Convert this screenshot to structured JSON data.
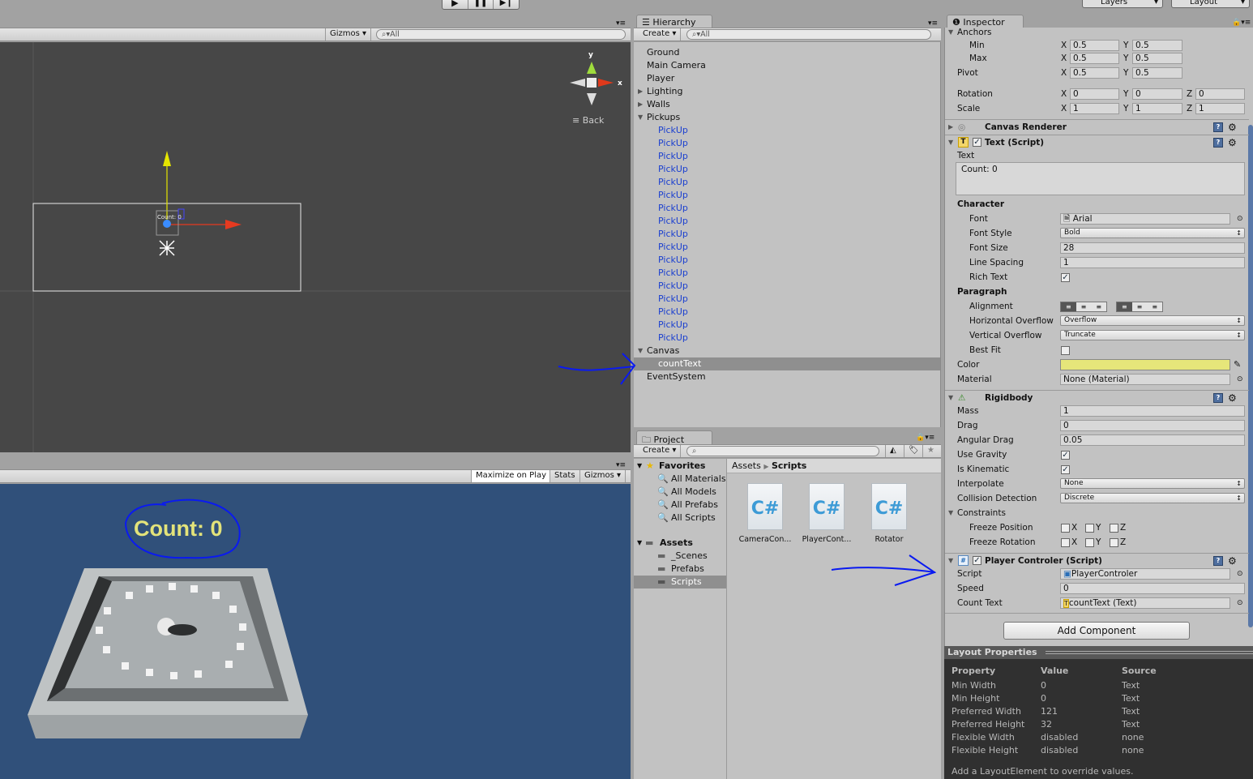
{
  "toolbar": {
    "play_icon": "play-icon",
    "pause_icon": "pause-icon",
    "step_icon": "step-icon",
    "layers": "Layers",
    "layout": "Layout"
  },
  "scene": {
    "gizmos": "Gizmos",
    "search": "All",
    "gizmo_y": "y",
    "gizmo_x": "x",
    "view_label": "Back",
    "ui_text": "Count: 0"
  },
  "game": {
    "maximize": "Maximize on Play",
    "stats": "Stats",
    "gizmos": "Gizmos",
    "count_text": "Count: 0",
    "bg_color": "#30507a",
    "text_color": "#e3e37a"
  },
  "hierarchy": {
    "tab": "Hierarchy",
    "create": "Create",
    "search": "All",
    "items": [
      {
        "name": "Ground",
        "level": 0,
        "arrow": ""
      },
      {
        "name": "Main Camera",
        "level": 0,
        "arrow": ""
      },
      {
        "name": "Player",
        "level": 0,
        "arrow": ""
      },
      {
        "name": "Lighting",
        "level": 0,
        "arrow": "right"
      },
      {
        "name": "Walls",
        "level": 0,
        "arrow": "right"
      },
      {
        "name": "Pickups",
        "level": 0,
        "arrow": "down"
      },
      {
        "name": "PickUp",
        "level": 1,
        "prefab": true
      },
      {
        "name": "PickUp",
        "level": 1,
        "prefab": true
      },
      {
        "name": "PickUp",
        "level": 1,
        "prefab": true
      },
      {
        "name": "PickUp",
        "level": 1,
        "prefab": true
      },
      {
        "name": "PickUp",
        "level": 1,
        "prefab": true
      },
      {
        "name": "PickUp",
        "level": 1,
        "prefab": true
      },
      {
        "name": "PickUp",
        "level": 1,
        "prefab": true
      },
      {
        "name": "PickUp",
        "level": 1,
        "prefab": true
      },
      {
        "name": "PickUp",
        "level": 1,
        "prefab": true
      },
      {
        "name": "PickUp",
        "level": 1,
        "prefab": true
      },
      {
        "name": "PickUp",
        "level": 1,
        "prefab": true
      },
      {
        "name": "PickUp",
        "level": 1,
        "prefab": true
      },
      {
        "name": "PickUp",
        "level": 1,
        "prefab": true
      },
      {
        "name": "PickUp",
        "level": 1,
        "prefab": true
      },
      {
        "name": "PickUp",
        "level": 1,
        "prefab": true
      },
      {
        "name": "PickUp",
        "level": 1,
        "prefab": true
      },
      {
        "name": "PickUp",
        "level": 1,
        "prefab": true
      },
      {
        "name": "Canvas",
        "level": 0,
        "arrow": "down"
      },
      {
        "name": "countText",
        "level": 1,
        "selected": true
      },
      {
        "name": "EventSystem",
        "level": 0,
        "arrow": ""
      }
    ]
  },
  "project": {
    "tab": "Project",
    "create": "Create",
    "favorites": {
      "label": "Favorites",
      "items": [
        "All Materials",
        "All Models",
        "All Prefabs",
        "All Scripts"
      ]
    },
    "assets": {
      "label": "Assets",
      "items": [
        "_Scenes",
        "Prefabs",
        "Scripts"
      ],
      "selected": "Scripts"
    },
    "breadcrumb": [
      "Assets",
      "Scripts"
    ],
    "files": [
      "CameraCon...",
      "PlayerCont...",
      "Rotator"
    ]
  },
  "inspector": {
    "tab": "Inspector",
    "anchors": "Anchors",
    "min": "Min",
    "max": "Max",
    "pivot": "Pivot",
    "rotation": "Rotation",
    "scale": "Scale",
    "axis": {
      "x": "X",
      "y": "Y",
      "z": "Z"
    },
    "anchor_min": [
      "0.5",
      "0.5"
    ],
    "anchor_max": [
      "0.5",
      "0.5"
    ],
    "pivot_v": [
      "0.5",
      "0.5"
    ],
    "rotation_v": [
      "0",
      "0",
      "0"
    ],
    "scale_v": [
      "1",
      "1",
      "1"
    ],
    "canvas_renderer": "Canvas Renderer",
    "text_script": {
      "title": "Text (Script)",
      "text_label": "Text",
      "text_value": "Count: 0",
      "character": "Character",
      "font_l": "Font",
      "font_v": "Arial",
      "style_l": "Font Style",
      "style_v": "Bold",
      "size_l": "Font Size",
      "size_v": "28",
      "spacing_l": "Line Spacing",
      "spacing_v": "1",
      "rich_l": "Rich Text",
      "rich_v": true,
      "paragraph": "Paragraph",
      "align_l": "Alignment",
      "hover_l": "Horizontal Overflow",
      "hover_v": "Overflow",
      "vover_l": "Vertical Overflow",
      "vover_v": "Truncate",
      "bestfit_l": "Best Fit",
      "bestfit_v": false,
      "color_l": "Color",
      "color_v": "#e6e67a",
      "material_l": "Material",
      "material_v": "None (Material)"
    },
    "rigidbody": {
      "title": "Rigidbody",
      "mass_l": "Mass",
      "mass_v": "1",
      "drag_l": "Drag",
      "drag_v": "0",
      "adrag_l": "Angular Drag",
      "adrag_v": "0.05",
      "grav_l": "Use Gravity",
      "grav_v": true,
      "kin_l": "Is Kinematic",
      "kin_v": true,
      "interp_l": "Interpolate",
      "interp_v": "None",
      "coll_l": "Collision Detection",
      "coll_v": "Discrete",
      "constraints": "Constraints",
      "fpos_l": "Freeze Position",
      "frot_l": "Freeze Rotation"
    },
    "player": {
      "title": "Player Controler (Script)",
      "script_l": "Script",
      "script_v": "PlayerControler",
      "speed_l": "Speed",
      "speed_v": "0",
      "count_l": "Count Text",
      "count_v": "countText (Text)"
    },
    "add_component": "Add Component",
    "layout": {
      "title": "Layout Properties",
      "headers": [
        "Property",
        "Value",
        "Source"
      ],
      "rows": [
        [
          "Min Width",
          "0",
          "Text"
        ],
        [
          "Min Height",
          "0",
          "Text"
        ],
        [
          "Preferred Width",
          "121",
          "Text"
        ],
        [
          "Preferred Height",
          "32",
          "Text"
        ],
        [
          "Flexible Width",
          "disabled",
          "none"
        ],
        [
          "Flexible Height",
          "disabled",
          "none"
        ]
      ],
      "footer": "Add a LayoutElement to override values."
    }
  }
}
